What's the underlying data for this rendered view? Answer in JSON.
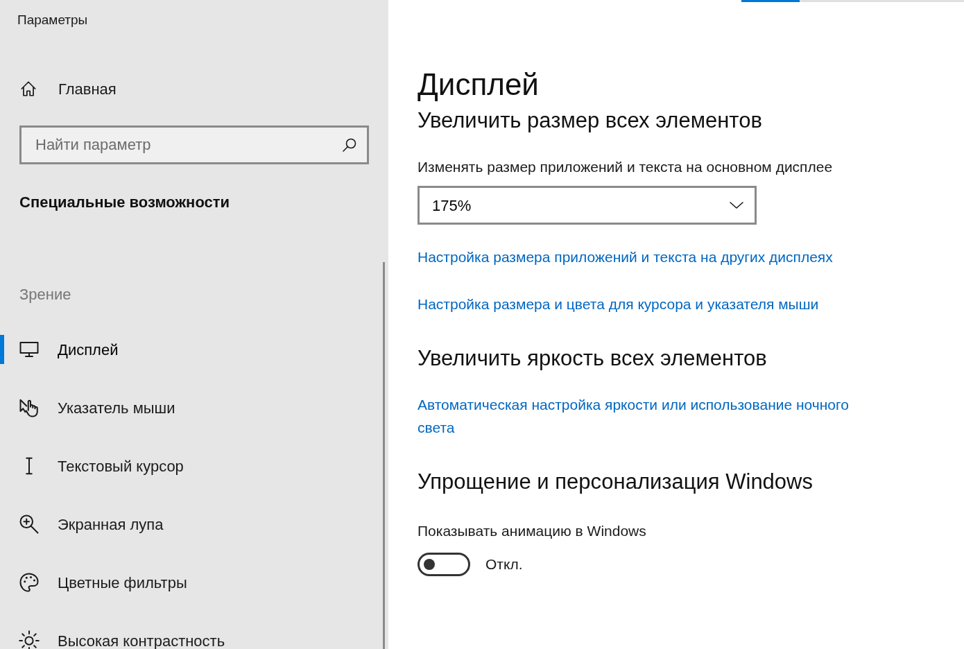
{
  "window": {
    "title": "Параметры"
  },
  "sidebar": {
    "home": {
      "label": "Главная"
    },
    "search": {
      "placeholder": "Найти параметр"
    },
    "section_title": "Специальные возможности",
    "group_label": "Зрение",
    "items": [
      {
        "label": "Дисплей",
        "selected": true
      },
      {
        "label": "Указатель мыши",
        "selected": false
      },
      {
        "label": "Текстовый курсор",
        "selected": false
      },
      {
        "label": "Экранная лупа",
        "selected": false
      },
      {
        "label": "Цветные фильтры",
        "selected": false
      },
      {
        "label": "Высокая контрастность",
        "selected": false
      }
    ]
  },
  "main": {
    "title": "Дисплей",
    "sections": [
      {
        "heading": "Увеличить размер всех элементов",
        "items": [
          {
            "kind": "dropdown",
            "label": "Изменять размер приложений и текста на основном дисплее",
            "value": "175%"
          },
          {
            "kind": "link",
            "text": "Настройка размера приложений и текста на других дисплеях"
          },
          {
            "kind": "link",
            "text": "Настройка размера и цвета для курсора и указателя мыши"
          }
        ]
      },
      {
        "heading": "Увеличить яркость всех элементов",
        "items": [
          {
            "kind": "link",
            "text": "Автоматическая настройка яркости или использование ночного света"
          }
        ]
      },
      {
        "heading": "Упрощение и персонализация Windows",
        "items": [
          {
            "kind": "toggle",
            "label": "Показывать анимацию в Windows",
            "on": false,
            "state_text": "Откл."
          }
        ]
      }
    ]
  }
}
